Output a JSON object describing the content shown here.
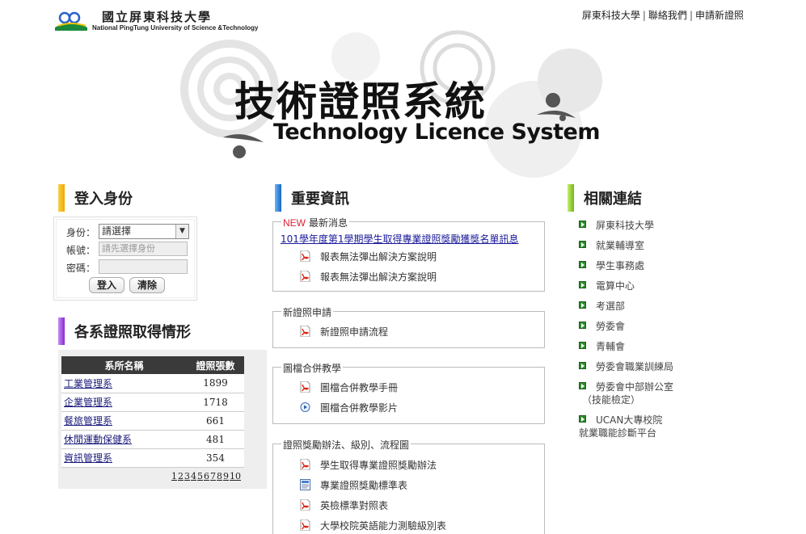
{
  "header": {
    "logo_zh": "國立屏東科技大學",
    "logo_en": "National PingTung University of Science &Technology",
    "links": [
      "屏東科技大學",
      "聯絡我們",
      "申請新證照"
    ]
  },
  "banner": {
    "title": "技術證照系統",
    "subtitle": "Technology Licence System"
  },
  "login": {
    "heading": "登入身份",
    "accent": "#f5b800",
    "identity_label": "身份：",
    "identity_value": "請選擇",
    "account_label": "帳號：",
    "account_placeholder": "請先選擇身份",
    "password_label": "密碼：",
    "login_button": "登入",
    "clear_button": "清除"
  },
  "dept": {
    "heading": "各系證照取得情形",
    "accent": "#9b3fd6",
    "col_name": "系所名稱",
    "col_count": "證照張數",
    "rows": [
      {
        "name": "工業管理系",
        "count": "1899"
      },
      {
        "name": "企業管理系",
        "count": "1718"
      },
      {
        "name": "餐旅管理系",
        "count": "661"
      },
      {
        "name": "休閒運動保健系",
        "count": "481"
      },
      {
        "name": "資訊管理系",
        "count": "354"
      }
    ],
    "pages": [
      "1",
      "2",
      "3",
      "4",
      "5",
      "6",
      "7",
      "8",
      "9",
      "10"
    ]
  },
  "info": {
    "heading": "重要資訊",
    "accent": "#1e7bd8",
    "news": {
      "new_badge": "NEW",
      "legend": "最新消息",
      "notice": "101學年度第1學期學生取得專業證照獎勵獲獎名單訊息",
      "items": [
        "報表無法彈出解決方案說明",
        "報表無法彈出解決方案說明"
      ]
    },
    "apply": {
      "legend": "新證照申請",
      "items": [
        "新證照申請流程"
      ]
    },
    "teaching": {
      "legend": "圖檔合併教學",
      "items": [
        "圖檔合併教學手冊",
        "圖檔合併教學影片"
      ]
    },
    "rules": {
      "legend": "證照獎勵辦法、級別、流程圖",
      "items": [
        "學生取得專業證照獎勵辦法",
        "專業證照獎勵標準表",
        "英檢標準對照表",
        "大學校院英語能力測驗級別表"
      ]
    }
  },
  "related": {
    "heading": "相關連結",
    "accent": "#8fd12a",
    "links": [
      [
        "屏東科技大學"
      ],
      [
        "就業輔導室"
      ],
      [
        "學生事務處"
      ],
      [
        "電算中心"
      ],
      [
        "考選部"
      ],
      [
        "勞委會"
      ],
      [
        "青輔會"
      ],
      [
        "勞委會職業訓練局"
      ],
      [
        "勞委會中部辦公室",
        "（技能檢定）"
      ],
      [
        "UCAN大專校院",
        "就業職能診斷平台"
      ]
    ]
  }
}
